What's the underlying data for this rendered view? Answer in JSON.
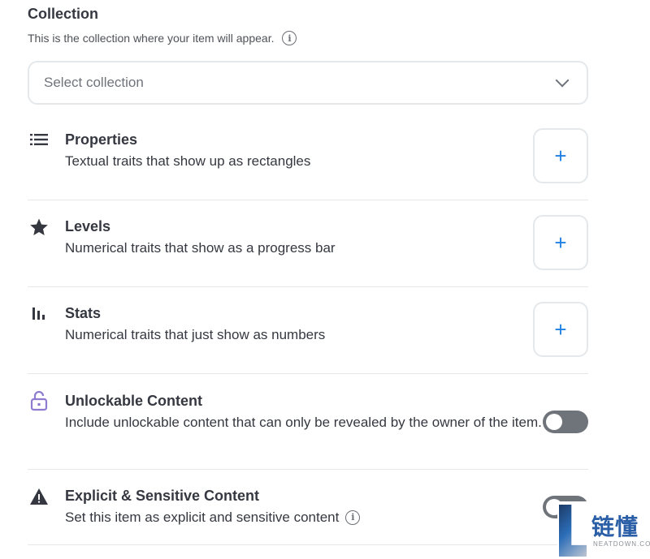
{
  "collection": {
    "title": "Collection",
    "subtitle": "This is the collection where your item will appear.",
    "info_icon": "info-icon",
    "select": {
      "placeholder": "Select collection",
      "icon": "chevron-down-icon"
    }
  },
  "sections": {
    "properties": {
      "icon": "list-icon",
      "title": "Properties",
      "description": "Textual traits that show up as rectangles",
      "action": "+"
    },
    "levels": {
      "icon": "star-icon",
      "title": "Levels",
      "description": "Numerical traits that show as a progress bar",
      "action": "+"
    },
    "stats": {
      "icon": "bar-chart-icon",
      "title": "Stats",
      "description": "Numerical traits that just show as numbers",
      "action": "+"
    },
    "unlockable": {
      "icon": "unlock-icon",
      "title": "Unlockable Content",
      "description": "Include unlockable content that can only be revealed by the owner of the item.",
      "enabled": false
    },
    "explicit": {
      "icon": "warning-icon",
      "title": "Explicit & Sensitive Content",
      "description": "Set this item as explicit and sensitive content",
      "enabled": false
    }
  },
  "colors": {
    "accent": "#2081e2",
    "text": "#353840",
    "border": "#e5e8eb",
    "toggle_off": "#6f737a",
    "unlock_icon": "#8f7bd0"
  },
  "watermark": {
    "text_cn": "链懂",
    "text_en": "NEATDOWN.COM"
  }
}
